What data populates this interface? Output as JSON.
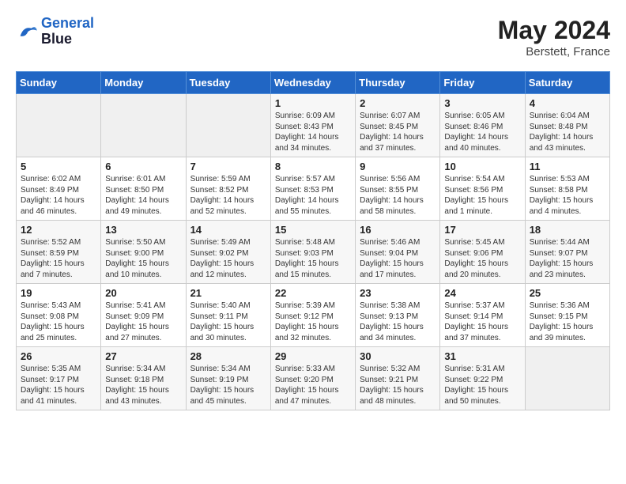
{
  "header": {
    "logo_line1": "General",
    "logo_line2": "Blue",
    "month_year": "May 2024",
    "location": "Berstett, France"
  },
  "weekdays": [
    "Sunday",
    "Monday",
    "Tuesday",
    "Wednesday",
    "Thursday",
    "Friday",
    "Saturday"
  ],
  "weeks": [
    [
      {
        "day": "",
        "empty": true
      },
      {
        "day": "",
        "empty": true
      },
      {
        "day": "",
        "empty": true
      },
      {
        "day": "1",
        "sunrise": "6:09 AM",
        "sunset": "8:43 PM",
        "daylight": "14 hours and 34 minutes."
      },
      {
        "day": "2",
        "sunrise": "6:07 AM",
        "sunset": "8:45 PM",
        "daylight": "14 hours and 37 minutes."
      },
      {
        "day": "3",
        "sunrise": "6:05 AM",
        "sunset": "8:46 PM",
        "daylight": "14 hours and 40 minutes."
      },
      {
        "day": "4",
        "sunrise": "6:04 AM",
        "sunset": "8:48 PM",
        "daylight": "14 hours and 43 minutes."
      }
    ],
    [
      {
        "day": "5",
        "sunrise": "6:02 AM",
        "sunset": "8:49 PM",
        "daylight": "14 hours and 46 minutes."
      },
      {
        "day": "6",
        "sunrise": "6:01 AM",
        "sunset": "8:50 PM",
        "daylight": "14 hours and 49 minutes."
      },
      {
        "day": "7",
        "sunrise": "5:59 AM",
        "sunset": "8:52 PM",
        "daylight": "14 hours and 52 minutes."
      },
      {
        "day": "8",
        "sunrise": "5:57 AM",
        "sunset": "8:53 PM",
        "daylight": "14 hours and 55 minutes."
      },
      {
        "day": "9",
        "sunrise": "5:56 AM",
        "sunset": "8:55 PM",
        "daylight": "14 hours and 58 minutes."
      },
      {
        "day": "10",
        "sunrise": "5:54 AM",
        "sunset": "8:56 PM",
        "daylight": "15 hours and 1 minute."
      },
      {
        "day": "11",
        "sunrise": "5:53 AM",
        "sunset": "8:58 PM",
        "daylight": "15 hours and 4 minutes."
      }
    ],
    [
      {
        "day": "12",
        "sunrise": "5:52 AM",
        "sunset": "8:59 PM",
        "daylight": "15 hours and 7 minutes."
      },
      {
        "day": "13",
        "sunrise": "5:50 AM",
        "sunset": "9:00 PM",
        "daylight": "15 hours and 10 minutes."
      },
      {
        "day": "14",
        "sunrise": "5:49 AM",
        "sunset": "9:02 PM",
        "daylight": "15 hours and 12 minutes."
      },
      {
        "day": "15",
        "sunrise": "5:48 AM",
        "sunset": "9:03 PM",
        "daylight": "15 hours and 15 minutes."
      },
      {
        "day": "16",
        "sunrise": "5:46 AM",
        "sunset": "9:04 PM",
        "daylight": "15 hours and 17 minutes."
      },
      {
        "day": "17",
        "sunrise": "5:45 AM",
        "sunset": "9:06 PM",
        "daylight": "15 hours and 20 minutes."
      },
      {
        "day": "18",
        "sunrise": "5:44 AM",
        "sunset": "9:07 PM",
        "daylight": "15 hours and 23 minutes."
      }
    ],
    [
      {
        "day": "19",
        "sunrise": "5:43 AM",
        "sunset": "9:08 PM",
        "daylight": "15 hours and 25 minutes."
      },
      {
        "day": "20",
        "sunrise": "5:41 AM",
        "sunset": "9:09 PM",
        "daylight": "15 hours and 27 minutes."
      },
      {
        "day": "21",
        "sunrise": "5:40 AM",
        "sunset": "9:11 PM",
        "daylight": "15 hours and 30 minutes."
      },
      {
        "day": "22",
        "sunrise": "5:39 AM",
        "sunset": "9:12 PM",
        "daylight": "15 hours and 32 minutes."
      },
      {
        "day": "23",
        "sunrise": "5:38 AM",
        "sunset": "9:13 PM",
        "daylight": "15 hours and 34 minutes."
      },
      {
        "day": "24",
        "sunrise": "5:37 AM",
        "sunset": "9:14 PM",
        "daylight": "15 hours and 37 minutes."
      },
      {
        "day": "25",
        "sunrise": "5:36 AM",
        "sunset": "9:15 PM",
        "daylight": "15 hours and 39 minutes."
      }
    ],
    [
      {
        "day": "26",
        "sunrise": "5:35 AM",
        "sunset": "9:17 PM",
        "daylight": "15 hours and 41 minutes."
      },
      {
        "day": "27",
        "sunrise": "5:34 AM",
        "sunset": "9:18 PM",
        "daylight": "15 hours and 43 minutes."
      },
      {
        "day": "28",
        "sunrise": "5:34 AM",
        "sunset": "9:19 PM",
        "daylight": "15 hours and 45 minutes."
      },
      {
        "day": "29",
        "sunrise": "5:33 AM",
        "sunset": "9:20 PM",
        "daylight": "15 hours and 47 minutes."
      },
      {
        "day": "30",
        "sunrise": "5:32 AM",
        "sunset": "9:21 PM",
        "daylight": "15 hours and 48 minutes."
      },
      {
        "day": "31",
        "sunrise": "5:31 AM",
        "sunset": "9:22 PM",
        "daylight": "15 hours and 50 minutes."
      },
      {
        "day": "",
        "empty": true
      }
    ]
  ]
}
